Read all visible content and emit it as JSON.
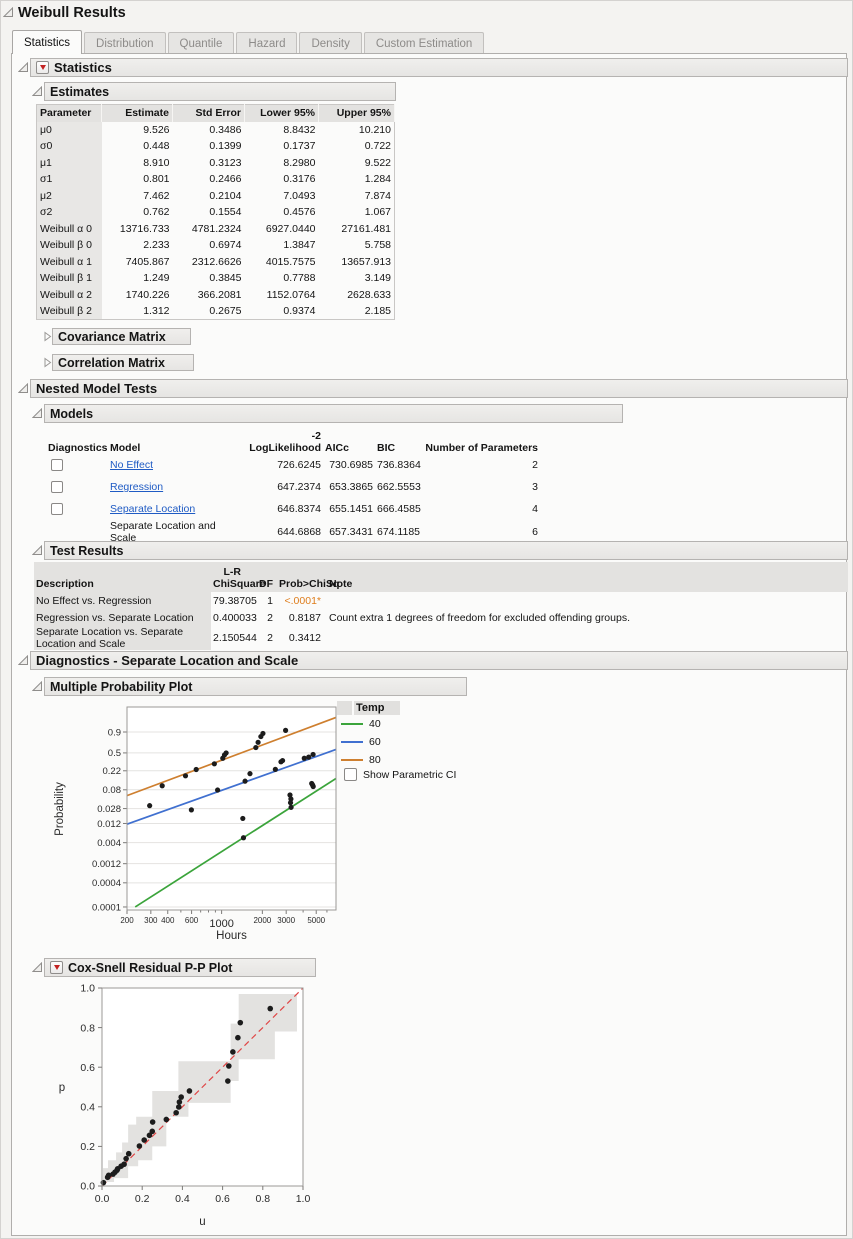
{
  "window": {
    "title": "Weibull Results"
  },
  "tabs": [
    {
      "label": "Statistics",
      "active": true
    },
    {
      "label": "Distribution",
      "active": false
    },
    {
      "label": "Quantile",
      "active": false
    },
    {
      "label": "Hazard",
      "active": false
    },
    {
      "label": "Density",
      "active": false
    },
    {
      "label": "Custom Estimation",
      "active": false
    }
  ],
  "statistics": {
    "title": "Statistics"
  },
  "estimates": {
    "title": "Estimates",
    "columns": [
      "Parameter",
      "Estimate",
      "Std Error",
      "Lower 95%",
      "Upper 95%"
    ],
    "rows": [
      [
        "μ0",
        "9.526",
        "0.3486",
        "8.8432",
        "10.210"
      ],
      [
        "σ0",
        "0.448",
        "0.1399",
        "0.1737",
        "0.722"
      ],
      [
        "μ1",
        "8.910",
        "0.3123",
        "8.2980",
        "9.522"
      ],
      [
        "σ1",
        "0.801",
        "0.2466",
        "0.3176",
        "1.284"
      ],
      [
        "μ2",
        "7.462",
        "0.2104",
        "7.0493",
        "7.874"
      ],
      [
        "σ2",
        "0.762",
        "0.1554",
        "0.4576",
        "1.067"
      ],
      [
        "Weibull α 0",
        "13716.733",
        "4781.2324",
        "6927.0440",
        "27161.481"
      ],
      [
        "Weibull β 0",
        "2.233",
        "0.6974",
        "1.3847",
        "5.758"
      ],
      [
        "Weibull α 1",
        "7405.867",
        "2312.6626",
        "4015.7575",
        "13657.913"
      ],
      [
        "Weibull β 1",
        "1.249",
        "0.3845",
        "0.7788",
        "3.149"
      ],
      [
        "Weibull α 2",
        "1740.226",
        "366.2081",
        "1152.0764",
        "2628.633"
      ],
      [
        "Weibull β 2",
        "1.312",
        "0.2675",
        "0.9374",
        "2.185"
      ]
    ]
  },
  "covariance": {
    "title": "Covariance Matrix"
  },
  "correlation": {
    "title": "Correlation Matrix"
  },
  "nested": {
    "title": "Nested Model Tests"
  },
  "models": {
    "title": "Models",
    "columns": [
      "Diagnostics",
      "Model",
      "-2 LogLikelihood",
      "AICc",
      "BIC",
      "Number of Parameters"
    ],
    "rows": [
      {
        "model": "No Effect",
        "is_link": true,
        "has_checkbox": true,
        "checked": false,
        "neg2loglik": "726.6245",
        "aicc": "730.6985",
        "bic": "736.8364",
        "n_params": "2"
      },
      {
        "model": "Regression",
        "is_link": true,
        "has_checkbox": true,
        "checked": false,
        "neg2loglik": "647.2374",
        "aicc": "653.3865",
        "bic": "662.5553",
        "n_params": "3"
      },
      {
        "model": "Separate Location",
        "is_link": true,
        "has_checkbox": true,
        "checked": false,
        "neg2loglik": "646.8374",
        "aicc": "655.1451",
        "bic": "666.4585",
        "n_params": "4"
      },
      {
        "model": "Separate Location and Scale",
        "is_link": false,
        "has_checkbox": false,
        "checked": false,
        "neg2loglik": "644.6868",
        "aicc": "657.3431",
        "bic": "674.1185",
        "n_params": "6"
      }
    ]
  },
  "test_results": {
    "title": "Test Results",
    "columns": {
      "description": "Description",
      "chisq_line1": "L-R",
      "chisq_line2": "ChiSquare",
      "df": "DF",
      "prob": "Prob>ChiSq",
      "note": "Note"
    },
    "rows": [
      {
        "description": "No Effect vs. Regression",
        "chisq": "79.38705",
        "df": "1",
        "prob": "<.0001*",
        "prob_significant": true,
        "note": ""
      },
      {
        "description": "Regression vs. Separate Location",
        "chisq": "0.400033",
        "df": "2",
        "prob": "0.8187",
        "prob_significant": false,
        "note": "Count extra 1 degrees of freedom for excluded offending groups."
      },
      {
        "description": "Separate Location vs. Separate Location and Scale",
        "chisq": "2.150544",
        "df": "2",
        "prob": "0.3412",
        "prob_significant": false,
        "note": ""
      }
    ]
  },
  "diagnostics": {
    "title": "Diagnostics - Separate Location and Scale"
  },
  "prob_plot": {
    "title": "Multiple Probability Plot"
  },
  "pp_plot": {
    "title": "Cox-Snell Residual P-P Plot"
  },
  "colors": {
    "link_blue": "#1f5bc4",
    "significant_orange": "#de7d1c",
    "temp40_green": "#3ba43b",
    "temp60_blue": "#4070d0",
    "temp80_orange": "#ce7f2f",
    "reference_red": "#e04545",
    "band_gray": "#e3e2e0",
    "point_black": "#1c1c1c"
  },
  "chart_data": [
    {
      "type": "line",
      "name": "multiple-probability-plot",
      "xlabel": "Hours",
      "ylabel": "Probability",
      "x_scale": "log",
      "y_scale": "weibull-probability",
      "xlim": [
        200,
        7000
      ],
      "ylim": [
        0.0001,
        0.9999
      ],
      "grid": "horizontal",
      "legend_position": "right",
      "legend_title": "Temp",
      "legend_checkbox_label": "Show Parametric CI",
      "legend_checkbox_checked": false,
      "x_ticks": [
        {
          "v": 200,
          "label": "200"
        },
        {
          "v": 300,
          "label": "300"
        },
        {
          "v": 400,
          "label": "400"
        },
        {
          "v": 500
        },
        {
          "v": 600,
          "label": "600"
        },
        {
          "v": 700
        },
        {
          "v": 800
        },
        {
          "v": 900
        },
        {
          "v": 1000,
          "label": "1000",
          "major": true
        },
        {
          "v": 2000,
          "label": "2000"
        },
        {
          "v": 3000,
          "label": "3000"
        },
        {
          "v": 4000
        },
        {
          "v": 5000,
          "label": "5000"
        },
        {
          "v": 6000
        }
      ],
      "y_ticks": [
        "0.9",
        "0.5",
        "0.22",
        "0.08",
        "0.028",
        "0.012",
        "0.004",
        "0.0012",
        "0.0004",
        "0.0001"
      ],
      "series": [
        {
          "name": "40",
          "color": "#3ba43b",
          "fit_line": [
            [
              230,
              0.0001
            ],
            [
              7000,
              0.148
            ]
          ],
          "points": [
            [
              1434,
              0.016
            ],
            [
              1451,
              0.0053
            ],
            [
              3200,
              0.06
            ],
            [
              3250,
              0.048
            ],
            [
              3230,
              0.039
            ],
            [
              3260,
              0.03
            ],
            [
              4630,
              0.113
            ],
            [
              4700,
              0.104
            ],
            [
              4750,
              0.096
            ]
          ]
        },
        {
          "name": "60",
          "color": "#4070d0",
          "fit_line": [
            [
              200,
              0.0115
            ],
            [
              7000,
              0.57
            ]
          ],
          "points": [
            [
              294,
              0.033
            ],
            [
              598,
              0.026
            ],
            [
              934,
              0.079
            ],
            [
              1490,
              0.128
            ],
            [
              1620,
              0.19
            ],
            [
              2495,
              0.236
            ],
            [
              2745,
              0.34
            ],
            [
              2820,
              0.36
            ],
            [
              4080,
              0.4
            ],
            [
              4400,
              0.42
            ],
            [
              4740,
              0.47
            ]
          ]
        },
        {
          "name": "80",
          "color": "#ce7f2f",
          "fit_line": [
            [
              200,
              0.058
            ],
            [
              7000,
              0.995
            ]
          ],
          "points": [
            [
              364,
              0.1
            ],
            [
              541,
              0.17
            ],
            [
              649,
              0.235
            ],
            [
              884,
              0.31
            ],
            [
              1020,
              0.4
            ],
            [
              1050,
              0.46
            ],
            [
              1080,
              0.5
            ],
            [
              1790,
              0.61
            ],
            [
              1860,
              0.72
            ],
            [
              1950,
              0.83
            ],
            [
              2020,
              0.88
            ],
            [
              2970,
              0.92
            ]
          ]
        }
      ]
    },
    {
      "type": "scatter",
      "name": "cox-snell-residual-pp-plot",
      "xlabel": "u",
      "ylabel": "p",
      "xlim": [
        0,
        1
      ],
      "ylim": [
        0,
        1
      ],
      "tick_labels": [
        "0.0",
        "0.2",
        "0.4",
        "0.6",
        "0.8",
        "1.0"
      ],
      "reference_line": {
        "from": [
          0,
          0
        ],
        "to": [
          1,
          1
        ],
        "style": "dashed",
        "color": "#e04545"
      },
      "confidence_band": [
        [
          0.005,
          0.02
        ],
        [
          0.005,
          0.09
        ],
        [
          0.03,
          0.09
        ],
        [
          0.03,
          0.13
        ],
        [
          0.07,
          0.13
        ],
        [
          0.07,
          0.17
        ],
        [
          0.1,
          0.17
        ],
        [
          0.1,
          0.22
        ],
        [
          0.13,
          0.22
        ],
        [
          0.13,
          0.31
        ],
        [
          0.17,
          0.31
        ],
        [
          0.17,
          0.35
        ],
        [
          0.25,
          0.35
        ],
        [
          0.25,
          0.48
        ],
        [
          0.38,
          0.48
        ],
        [
          0.38,
          0.63
        ],
        [
          0.64,
          0.63
        ],
        [
          0.64,
          0.82
        ],
        [
          0.68,
          0.82
        ],
        [
          0.68,
          0.97
        ],
        [
          0.97,
          0.97
        ],
        [
          0.97,
          0.78
        ],
        [
          0.86,
          0.78
        ],
        [
          0.86,
          0.64
        ],
        [
          0.68,
          0.64
        ],
        [
          0.68,
          0.53
        ],
        [
          0.64,
          0.53
        ],
        [
          0.64,
          0.42
        ],
        [
          0.43,
          0.42
        ],
        [
          0.43,
          0.35
        ],
        [
          0.32,
          0.35
        ],
        [
          0.32,
          0.2
        ],
        [
          0.25,
          0.2
        ],
        [
          0.25,
          0.13
        ],
        [
          0.18,
          0.13
        ],
        [
          0.18,
          0.1
        ],
        [
          0.13,
          0.1
        ],
        [
          0.13,
          0.04
        ],
        [
          0.06,
          0.04
        ],
        [
          0.06,
          0.02
        ]
      ],
      "points": [
        [
          0.007,
          0.017
        ],
        [
          0.028,
          0.044
        ],
        [
          0.033,
          0.054
        ],
        [
          0.055,
          0.06
        ],
        [
          0.065,
          0.07
        ],
        [
          0.075,
          0.08
        ],
        [
          0.078,
          0.087
        ],
        [
          0.095,
          0.1
        ],
        [
          0.11,
          0.11
        ],
        [
          0.12,
          0.138
        ],
        [
          0.133,
          0.163
        ],
        [
          0.186,
          0.202
        ],
        [
          0.21,
          0.232
        ],
        [
          0.236,
          0.256
        ],
        [
          0.25,
          0.276
        ],
        [
          0.252,
          0.323
        ],
        [
          0.32,
          0.336
        ],
        [
          0.369,
          0.37
        ],
        [
          0.382,
          0.399
        ],
        [
          0.385,
          0.424
        ],
        [
          0.394,
          0.449
        ],
        [
          0.435,
          0.48
        ],
        [
          0.626,
          0.53
        ],
        [
          0.631,
          0.606
        ],
        [
          0.651,
          0.677
        ],
        [
          0.676,
          0.749
        ],
        [
          0.688,
          0.825
        ],
        [
          0.837,
          0.896
        ]
      ]
    }
  ]
}
